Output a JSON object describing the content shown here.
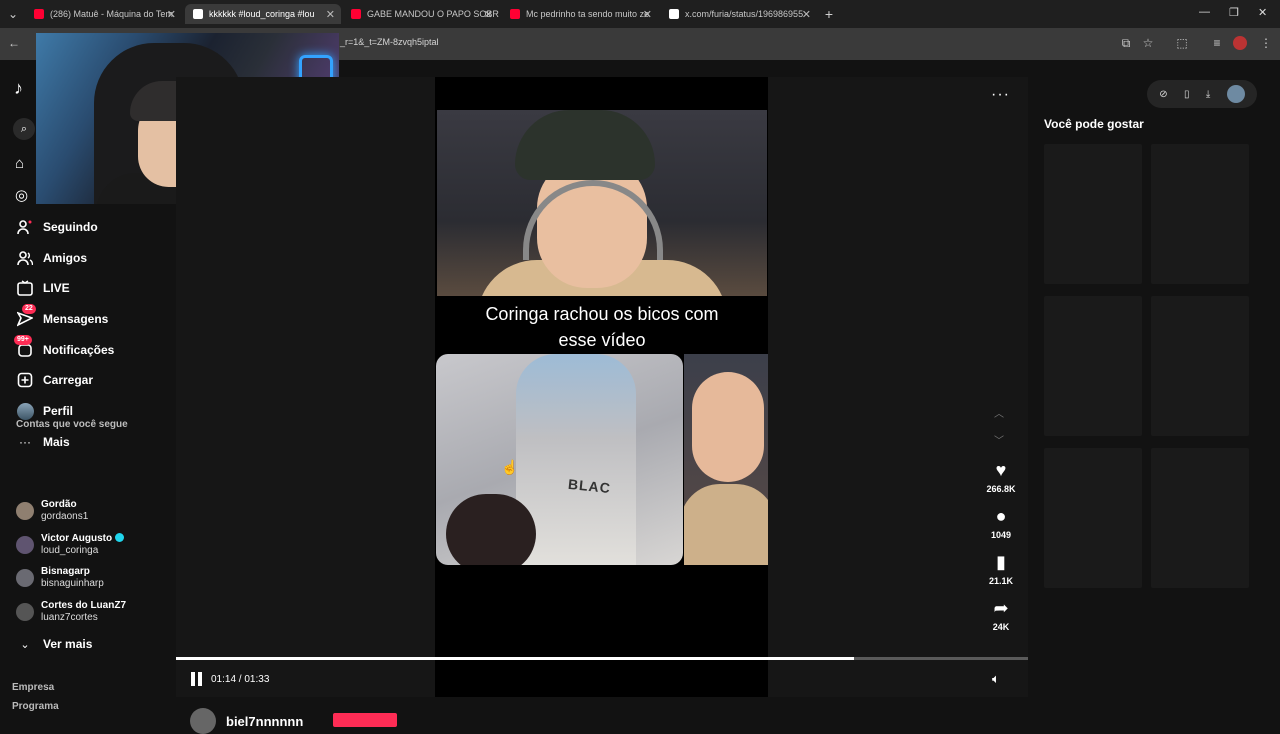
{
  "browser": {
    "tabs": [
      {
        "title": "(286) Matuê - Máquina do Tem",
        "icon_color": "#ff0033",
        "active": false
      },
      {
        "title": "kkkkkk #loud_coringa #lou",
        "icon_color": "#ffffff",
        "active": true
      },
      {
        "title": "GABE MANDOU O PAPO SOBR",
        "icon_color": "#ff0033",
        "active": false
      },
      {
        "title": "Mc pedrinho ta sendo muito ze",
        "icon_color": "#ff0033",
        "active": false
      },
      {
        "title": "x.com/furia/status/196986955",
        "icon_color": "#ffffff",
        "active": false
      }
    ],
    "new_tab": "+",
    "url": "_r=1&_t=ZM-8zvqh5iptal"
  },
  "sidebar": {
    "nav": [
      {
        "label": "Seguindo",
        "icon": "following-icon"
      },
      {
        "label": "Amigos",
        "icon": "friends-icon"
      },
      {
        "label": "LIVE",
        "icon": "live-icon"
      },
      {
        "label": "Mensagens",
        "icon": "messages-icon",
        "badge": "22"
      },
      {
        "label": "Notificações",
        "icon": "notifications-icon",
        "badge": "99+"
      },
      {
        "label": "Carregar",
        "icon": "upload-icon"
      },
      {
        "label": "Perfil",
        "icon": "profile-avatar"
      },
      {
        "label": "Mais",
        "icon": "more-icon"
      }
    ],
    "following_title": "Contas que você segue",
    "accounts": [
      {
        "name": "Gordão",
        "handle": "gordaons1",
        "verified": false
      },
      {
        "name": "Victor Augusto",
        "handle": "loud_coringa",
        "verified": true
      },
      {
        "name": "Bisnagarp",
        "handle": "bisnaguinharp",
        "verified": false
      },
      {
        "name": "Cortes do LuanZ7",
        "handle": "luanz7cortes",
        "verified": false
      }
    ],
    "see_more": "Ver mais",
    "footer": [
      "Empresa",
      "Programa"
    ]
  },
  "video": {
    "caption_line1": "Coringa rachou os bicos com",
    "caption_line2": "esse vídeo",
    "shirt_print": "BLAC",
    "likes": "266.8K",
    "comments": "1049",
    "saves": "21.1K",
    "shares": "24K",
    "time": "01:14 / 01:33",
    "progress": 0.796,
    "author": "biel7nnnnnn"
  },
  "right_panel": {
    "title": "Você pode gostar"
  },
  "colors": {
    "accent": "#fe2c55",
    "background": "#121212"
  }
}
